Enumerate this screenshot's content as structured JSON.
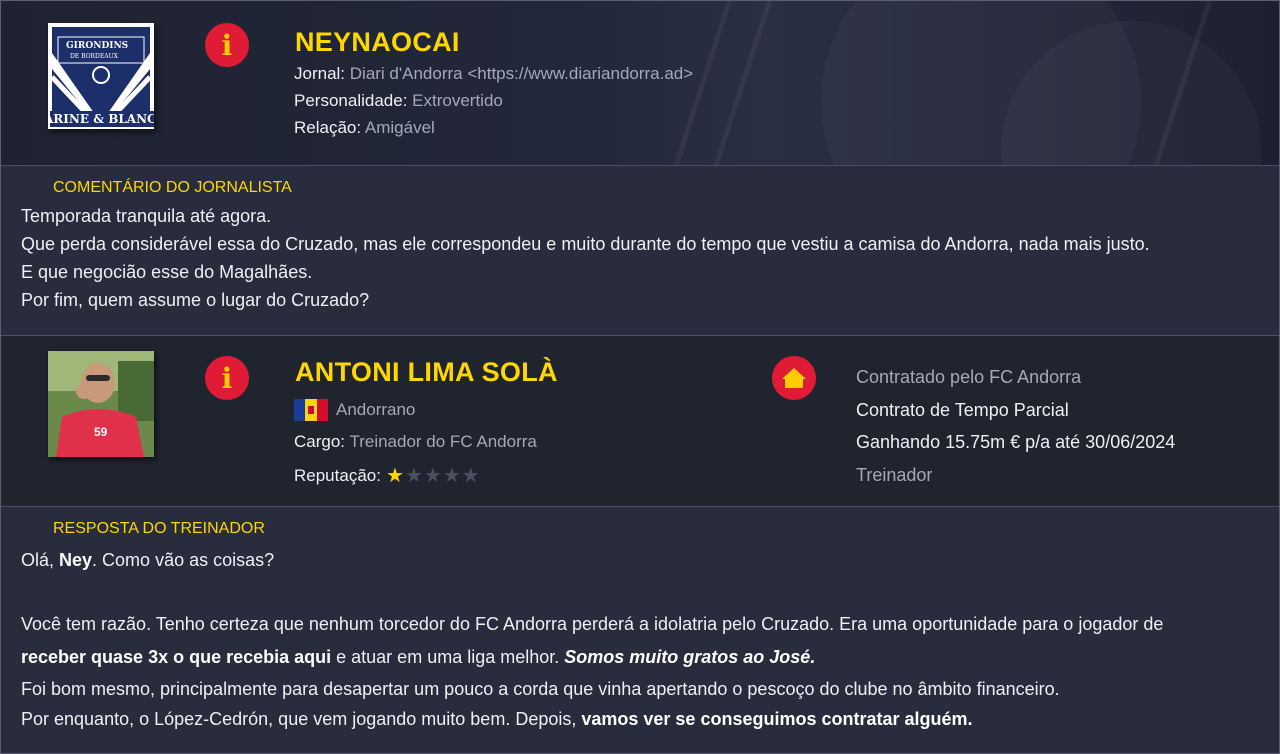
{
  "journalist": {
    "name": "NEYNAOCAI",
    "logo_text_top": "GIRONDINS",
    "logo_text_mid": "DE BORDEAUX",
    "logo_text_bottom": "ARINE & BLANC",
    "journal_label": "Jornal:",
    "journal_value": "Diari d'Andorra <https://www.diariandorra.ad>",
    "personality_label": "Personalidade:",
    "personality_value": "Extrovertido",
    "relation_label": "Relação:",
    "relation_value": "Amigável"
  },
  "journalist_comment": {
    "title": "COMENTÁRIO DO JORNALISTA",
    "lines": [
      "Temporada tranquila até agora.",
      "Que perda considerável essa do Cruzado, mas ele correspondeu e muito durante do tempo que vestiu a camisa do Andorra, nada mais justo.",
      "E que negocião esse do Magalhães.",
      "Por fim, quem assume o lugar do Cruzado?"
    ]
  },
  "coach": {
    "name": "ANTONI LIMA SOLÀ",
    "nationality": "Andorrano",
    "role_label": "Cargo:",
    "role_value": "Treinador do FC Andorra",
    "reputation_label": "Reputação:",
    "reputation_stars": 1,
    "reputation_max": 5,
    "contract_line1": "Contratado pelo FC Andorra",
    "contract_line2": "Contrato de Tempo Parcial",
    "contract_line3": "Ganhando 15.75m € p/a até 30/06/2024",
    "contract_line4": "Treinador",
    "photo_shirt_number": "59"
  },
  "coach_response": {
    "title": "RESPOSTA DO TREINADOR",
    "greeting_pre": "Olá, ",
    "greeting_name": "Ney",
    "greeting_post": ". Como vão as coisas?",
    "p1_a": "Você tem razão. Tenho certeza que nenhum torcedor do FC Andorra perderá a idolatria pelo Cruzado. Era uma oportunidade para o jogador de",
    "p1_b_bold": "receber quase 3x o que recebia aqui",
    "p1_b_mid": " e atuar em uma liga melhor. ",
    "p1_b_italic": "Somos muito gratos ao José.",
    "p2": "Foi bom mesmo, principalmente para desapertar um pouco a corda que vinha apertando o pescoço do clube no âmbito financeiro.",
    "p3_a": "Por enquanto, o López-Cedrón, que vem jogando muito bem. Depois, ",
    "p3_bold": "vamos ver se conseguimos contratar alguém."
  },
  "colors": {
    "accent": "#ffd700",
    "icon_red": "#e01b35",
    "background": "#282c3d"
  },
  "icons": {
    "info": "info-icon",
    "home": "home-icon",
    "flag": "andorra-flag-icon",
    "star": "star-icon"
  }
}
